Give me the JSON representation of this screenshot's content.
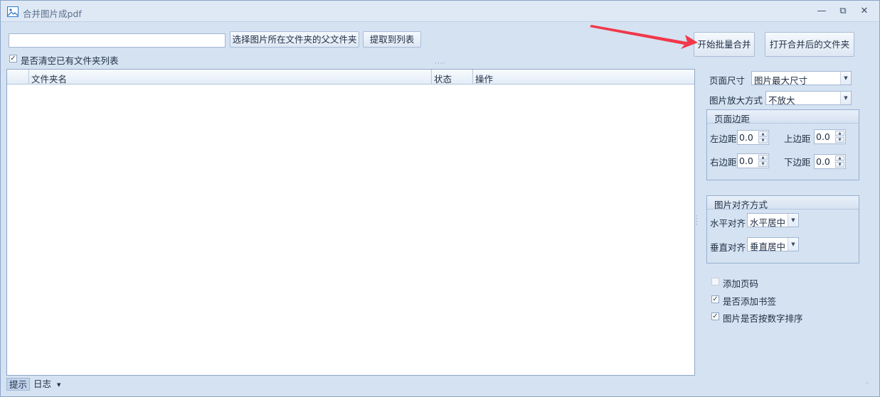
{
  "window": {
    "title": "合并图片成pdf",
    "minimize": "—",
    "restore": "⧉",
    "close": "✕"
  },
  "toolbar": {
    "path_value": "",
    "select_parent_folder_label": "选择图片所在文件夹的父文件夹",
    "extract_to_list_label": "提取到列表",
    "clear_list_label": "是否清空已有文件夹列表",
    "clear_list_checked": true,
    "start_merge_label": "开始批量合并",
    "open_output_folder_label": "打开合并后的文件夹"
  },
  "grid": {
    "columns": [
      "文件夹名",
      "状态",
      "操作"
    ],
    "rows": []
  },
  "settings": {
    "page_size_label": "页面尺寸",
    "page_size_value": "图片最大尺寸",
    "zoom_mode_label": "图片放大方式",
    "zoom_mode_value": "不放大",
    "margins": {
      "title": "页面边距",
      "left_label": "左边距",
      "left_value": "0.0",
      "top_label": "上边距",
      "top_value": "0.0",
      "right_label": "右边距",
      "right_value": "0.0",
      "bottom_label": "下边距",
      "bottom_value": "0.0"
    },
    "alignment": {
      "title": "图片对齐方式",
      "horizontal_label": "水平对齐",
      "horizontal_value": "水平居中",
      "vertical_label": "垂直对齐",
      "vertical_value": "垂直居中"
    },
    "add_page_number_label": "添加页码",
    "add_page_number_checked": false,
    "add_bookmark_label": "是否添加书签",
    "add_bookmark_checked": true,
    "numeric_sort_label": "图片是否按数字排序",
    "numeric_sort_checked": true
  },
  "statusbar": {
    "tips_tab": "提示",
    "log_tab": "日志"
  },
  "colors": {
    "background": "#d5e2f1",
    "annotation_arrow": "#f0384a"
  },
  "icons": {
    "app": "image-icon",
    "dropdown": "chevron-down-icon",
    "spin": "spin-arrows-icon",
    "check": "check-icon"
  }
}
